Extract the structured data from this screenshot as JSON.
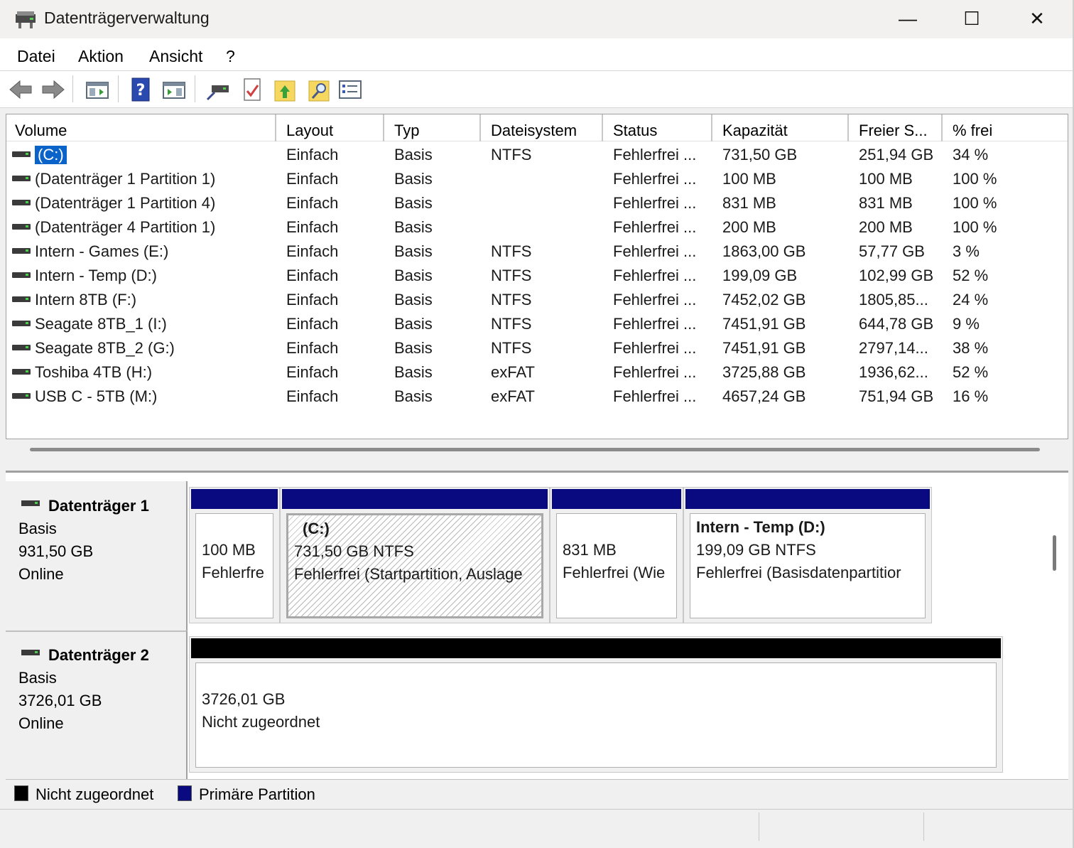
{
  "window": {
    "title": "Datenträgerverwaltung",
    "controls": {
      "minimize": "—",
      "maximize": "☐",
      "close": "✕"
    }
  },
  "menu": [
    "Datei",
    "Aktion",
    "Ansicht",
    "?"
  ],
  "toolbar": {
    "icons": [
      "back-arrow-icon",
      "forward-arrow-icon",
      "console-tree-icon",
      "help-icon",
      "action-pane-icon",
      "connect-disk-icon",
      "properties-check-icon",
      "folder-up-icon",
      "folder-search-icon",
      "list-view-icon"
    ]
  },
  "columns": [
    "Volume",
    "Layout",
    "Typ",
    "Dateisystem",
    "Status",
    "Kapazität",
    "Freier S...",
    "% frei"
  ],
  "volumes": [
    {
      "name": "(C:)",
      "layout": "Einfach",
      "type": "Basis",
      "fs": "NTFS",
      "status": "Fehlerfrei ...",
      "capacity": "731,50 GB",
      "free": "251,94 GB",
      "pct": "34 %",
      "selected": true
    },
    {
      "name": "(Datenträger 1 Partition 1)",
      "layout": "Einfach",
      "type": "Basis",
      "fs": "",
      "status": "Fehlerfrei ...",
      "capacity": "100 MB",
      "free": "100 MB",
      "pct": "100 %"
    },
    {
      "name": "(Datenträger 1 Partition 4)",
      "layout": "Einfach",
      "type": "Basis",
      "fs": "",
      "status": "Fehlerfrei ...",
      "capacity": "831 MB",
      "free": "831 MB",
      "pct": "100 %"
    },
    {
      "name": "(Datenträger 4 Partition 1)",
      "layout": "Einfach",
      "type": "Basis",
      "fs": "",
      "status": "Fehlerfrei ...",
      "capacity": "200 MB",
      "free": "200 MB",
      "pct": "100 %"
    },
    {
      "name": "Intern - Games  (E:)",
      "layout": "Einfach",
      "type": "Basis",
      "fs": "NTFS",
      "status": "Fehlerfrei ...",
      "capacity": "1863,00 GB",
      "free": "57,77 GB",
      "pct": "3 %"
    },
    {
      "name": "Intern - Temp (D:)",
      "layout": "Einfach",
      "type": "Basis",
      "fs": "NTFS",
      "status": "Fehlerfrei ...",
      "capacity": "199,09 GB",
      "free": "102,99 GB",
      "pct": "52 %"
    },
    {
      "name": "Intern 8TB (F:)",
      "layout": "Einfach",
      "type": "Basis",
      "fs": "NTFS",
      "status": "Fehlerfrei ...",
      "capacity": "7452,02 GB",
      "free": "1805,85...",
      "pct": "24 %"
    },
    {
      "name": "Seagate 8TB_1 (I:)",
      "layout": "Einfach",
      "type": "Basis",
      "fs": "NTFS",
      "status": "Fehlerfrei ...",
      "capacity": "7451,91 GB",
      "free": "644,78 GB",
      "pct": "9 %"
    },
    {
      "name": "Seagate 8TB_2 (G:)",
      "layout": "Einfach",
      "type": "Basis",
      "fs": "NTFS",
      "status": "Fehlerfrei ...",
      "capacity": "7451,91 GB",
      "free": "2797,14...",
      "pct": "38 %"
    },
    {
      "name": "Toshiba 4TB (H:)",
      "layout": "Einfach",
      "type": "Basis",
      "fs": "exFAT",
      "status": "Fehlerfrei ...",
      "capacity": "3725,88 GB",
      "free": "1936,62...",
      "pct": "52 %"
    },
    {
      "name": "USB C - 5TB (M:)",
      "layout": "Einfach",
      "type": "Basis",
      "fs": "exFAT",
      "status": "Fehlerfrei ...",
      "capacity": "4657,24 GB",
      "free": "751,94 GB",
      "pct": "16 %"
    }
  ],
  "disks": [
    {
      "title": "Datenträger 1",
      "type": "Basis",
      "size": "931,50 GB",
      "state": "Online",
      "partitions": [
        {
          "name": "",
          "line1": "100 MB",
          "line2": "Fehlerfre",
          "kind": "primary"
        },
        {
          "name": "(C:)",
          "line1": "731,50 GB NTFS",
          "line2": "Fehlerfrei (Startpartition, Auslage",
          "kind": "primary",
          "selected": true
        },
        {
          "name": "",
          "line1": "831 MB",
          "line2": "Fehlerfrei (Wie",
          "kind": "primary"
        },
        {
          "name": "Intern - Temp  (D:)",
          "line1": "199,09 GB NTFS",
          "line2": "Fehlerfrei (Basisdatenpartitior",
          "kind": "primary"
        }
      ]
    },
    {
      "title": "Datenträger 2",
      "type": "Basis",
      "size": "3726,01 GB",
      "state": "Online",
      "partitions": [
        {
          "name": "",
          "line1": "3726,01 GB",
          "line2": "Nicht zugeordnet",
          "kind": "unallocated"
        }
      ]
    }
  ],
  "legend": [
    {
      "label": "Nicht zugeordnet",
      "color": "#000000"
    },
    {
      "label": "Primäre Partition",
      "color": "#0a0a80"
    }
  ],
  "colors": {
    "primary": "#0a0a80",
    "unallocated": "#000000",
    "selection": "#0a63c9"
  }
}
